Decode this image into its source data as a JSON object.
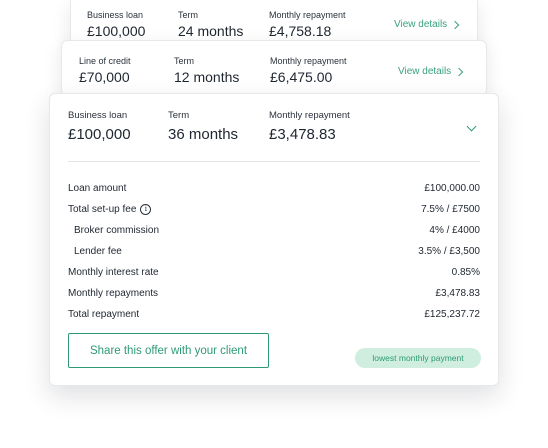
{
  "offers": [
    {
      "product_label": "Business loan",
      "product_value": "£100,000",
      "term_label": "Term",
      "term_value": "24 months",
      "repayment_label": "Monthly repayment",
      "repayment_value": "£4,758.18",
      "details_link": "View details"
    },
    {
      "product_label": "Line of credit",
      "product_value": "£70,000",
      "term_label": "Term",
      "term_value": "12 months",
      "repayment_label": "Monthly repayment",
      "repayment_value": "£6,475.00",
      "details_link": "View details"
    },
    {
      "product_label": "Business loan",
      "product_value": "£100,000",
      "term_label": "Term",
      "term_value": "36 months",
      "repayment_label": "Monthly repayment",
      "repayment_value": "£3,478.83",
      "expanded": true,
      "breakdown": [
        {
          "label": "Loan amount",
          "value": "£100,000.00"
        },
        {
          "label": "Total set-up fee",
          "value": "7.5% / £7500",
          "info_icon": "info-icon"
        },
        {
          "label": "Broker commission",
          "value": "4% / £4000"
        },
        {
          "label": "Lender fee",
          "value": "3.5% / £3,500"
        },
        {
          "label": "Monthly interest rate",
          "value": "0.85%"
        },
        {
          "label": "Monthly repayments",
          "value": "£3,478.83"
        },
        {
          "label": "Total repayment",
          "value": "£125,237.72"
        }
      ],
      "share_button": "Share this offer with your client",
      "badge": "lowest monthly payment"
    }
  ],
  "colors": {
    "accent": "#2e9a76",
    "badge_bg": "#cfeee0",
    "text": "#1f2630",
    "border": "#e6e8ea"
  }
}
